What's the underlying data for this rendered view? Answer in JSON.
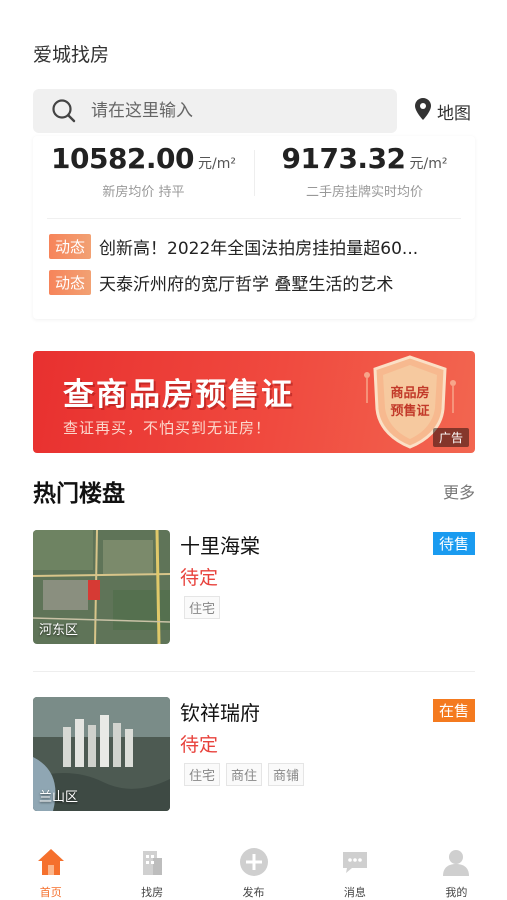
{
  "header": {
    "city_title": "爱城找房"
  },
  "search": {
    "placeholder": "请在这里输入",
    "map_label": "地图"
  },
  "prices": {
    "new_house": {
      "value": "10582.00",
      "unit": "元/m²",
      "label": "新房均价 持平"
    },
    "second_hand": {
      "value": "9173.32",
      "unit": "元/m²",
      "label": "二手房挂牌实时均价"
    }
  },
  "news": [
    {
      "badge": "动态",
      "text": "创新高！2022年全国法拍房挂拍量超60..."
    },
    {
      "badge": "动态",
      "text": "天泰沂州府的宽厅哲学 叠墅生活的艺术"
    }
  ],
  "banner": {
    "title": "查商品房预售证",
    "subtitle": "查证再买，不怕买到无证房！",
    "shield_text_line1": "商品房",
    "shield_text_line2": "预售证",
    "ad_label": "广告"
  },
  "hot_section": {
    "title": "热门楼盘",
    "more_label": "更多"
  },
  "listings": [
    {
      "name": "十里海棠",
      "price": "待定",
      "tags": [
        "住宅"
      ],
      "status": "待售",
      "status_color": "#1a9bf0",
      "district": "河东区"
    },
    {
      "name": "钦祥瑞府",
      "price": "待定",
      "tags": [
        "住宅",
        "商住",
        "商铺"
      ],
      "status": "在售",
      "status_color": "#f47a1f",
      "district": "兰山区"
    }
  ],
  "tabbar": [
    {
      "label": "首页",
      "icon": "home-icon",
      "active": true
    },
    {
      "label": "找房",
      "icon": "building-icon",
      "active": false
    },
    {
      "label": "发布",
      "icon": "plus-circle-icon",
      "active": false
    },
    {
      "label": "消息",
      "icon": "message-icon",
      "active": false
    },
    {
      "label": "我的",
      "icon": "user-icon",
      "active": false
    }
  ],
  "colors": {
    "accent": "#f5702d",
    "price_red": "#e8423c",
    "banner_red": "#e8302f"
  }
}
